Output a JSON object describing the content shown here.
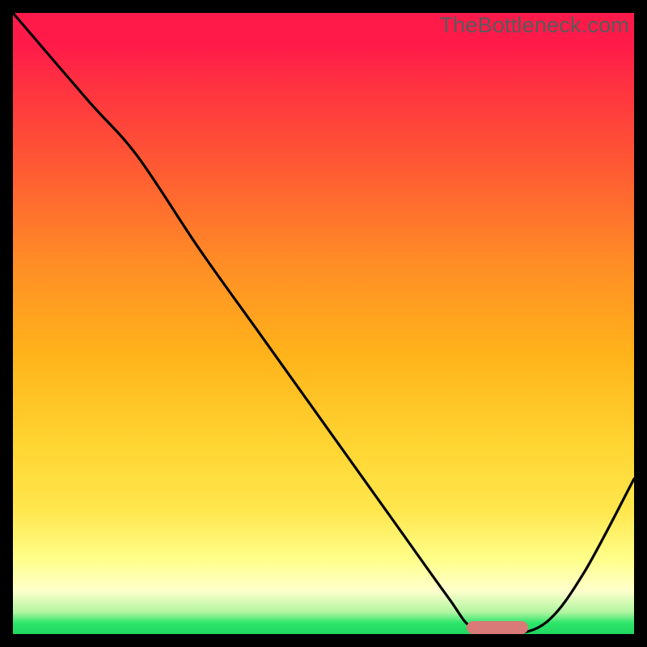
{
  "watermark": "TheBottleneck.com",
  "colors": {
    "frame": "#000000",
    "curve": "#000000",
    "marker": "#d97a78",
    "gradient_top": "#ff1a4a",
    "gradient_bottom": "#1fd65f"
  },
  "chart_data": {
    "type": "line",
    "title": "",
    "xlabel": "",
    "ylabel": "",
    "xlim": [
      0,
      100
    ],
    "ylim": [
      0,
      100
    ],
    "grid": false,
    "legend": false,
    "series": [
      {
        "name": "bottleneck-curve",
        "x": [
          0,
          12,
          20,
          30,
          40,
          50,
          60,
          70,
          74,
          80,
          86,
          92,
          100
        ],
        "values": [
          100,
          86,
          77,
          62,
          48,
          34,
          20,
          6,
          1,
          0,
          2,
          10,
          25
        ]
      }
    ],
    "annotations": [
      {
        "name": "optimal-marker",
        "shape": "rounded-bar",
        "x_range": [
          73,
          83
        ],
        "y": 1.0,
        "color": "#d97a78"
      }
    ]
  }
}
